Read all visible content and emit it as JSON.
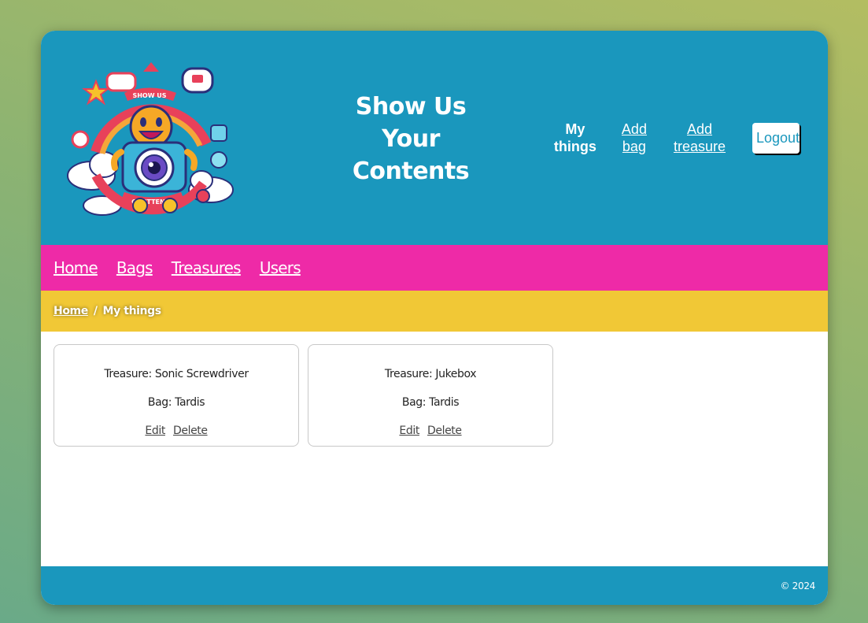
{
  "header": {
    "logo_text_top": "SHOW US",
    "logo_text_bottom": "CONTTENTS",
    "site_title_line1": "Show Us",
    "site_title_line2": "Your",
    "site_title_line3": "Contents"
  },
  "top_nav": {
    "my_things_line1": "My",
    "my_things_line2": "things",
    "add_bag_line1": "Add",
    "add_bag_line2": "bag",
    "add_treasure_line1": "Add",
    "add_treasure_line2": "treasure",
    "logout_label": "Logout"
  },
  "main_nav": {
    "items": [
      {
        "label": "Home"
      },
      {
        "label": "Bags"
      },
      {
        "label": "Treasures"
      },
      {
        "label": "Users"
      }
    ]
  },
  "breadcrumb": {
    "home": "Home",
    "separator": "/",
    "current": "My things"
  },
  "cards": [
    {
      "treasure": "Treasure: Sonic Screwdriver",
      "bag": "Bag: Tardis",
      "edit": "Edit",
      "delete": "Delete"
    },
    {
      "treasure": "Treasure: Jukebox",
      "bag": "Bag: Tardis",
      "edit": "Edit",
      "delete": "Delete"
    }
  ],
  "footer": {
    "copyright": "© 2024"
  },
  "colors": {
    "header_bg": "#1a97bd",
    "nav_bg": "#ee2aa7",
    "breadcrumb_bg": "#f1c836"
  }
}
